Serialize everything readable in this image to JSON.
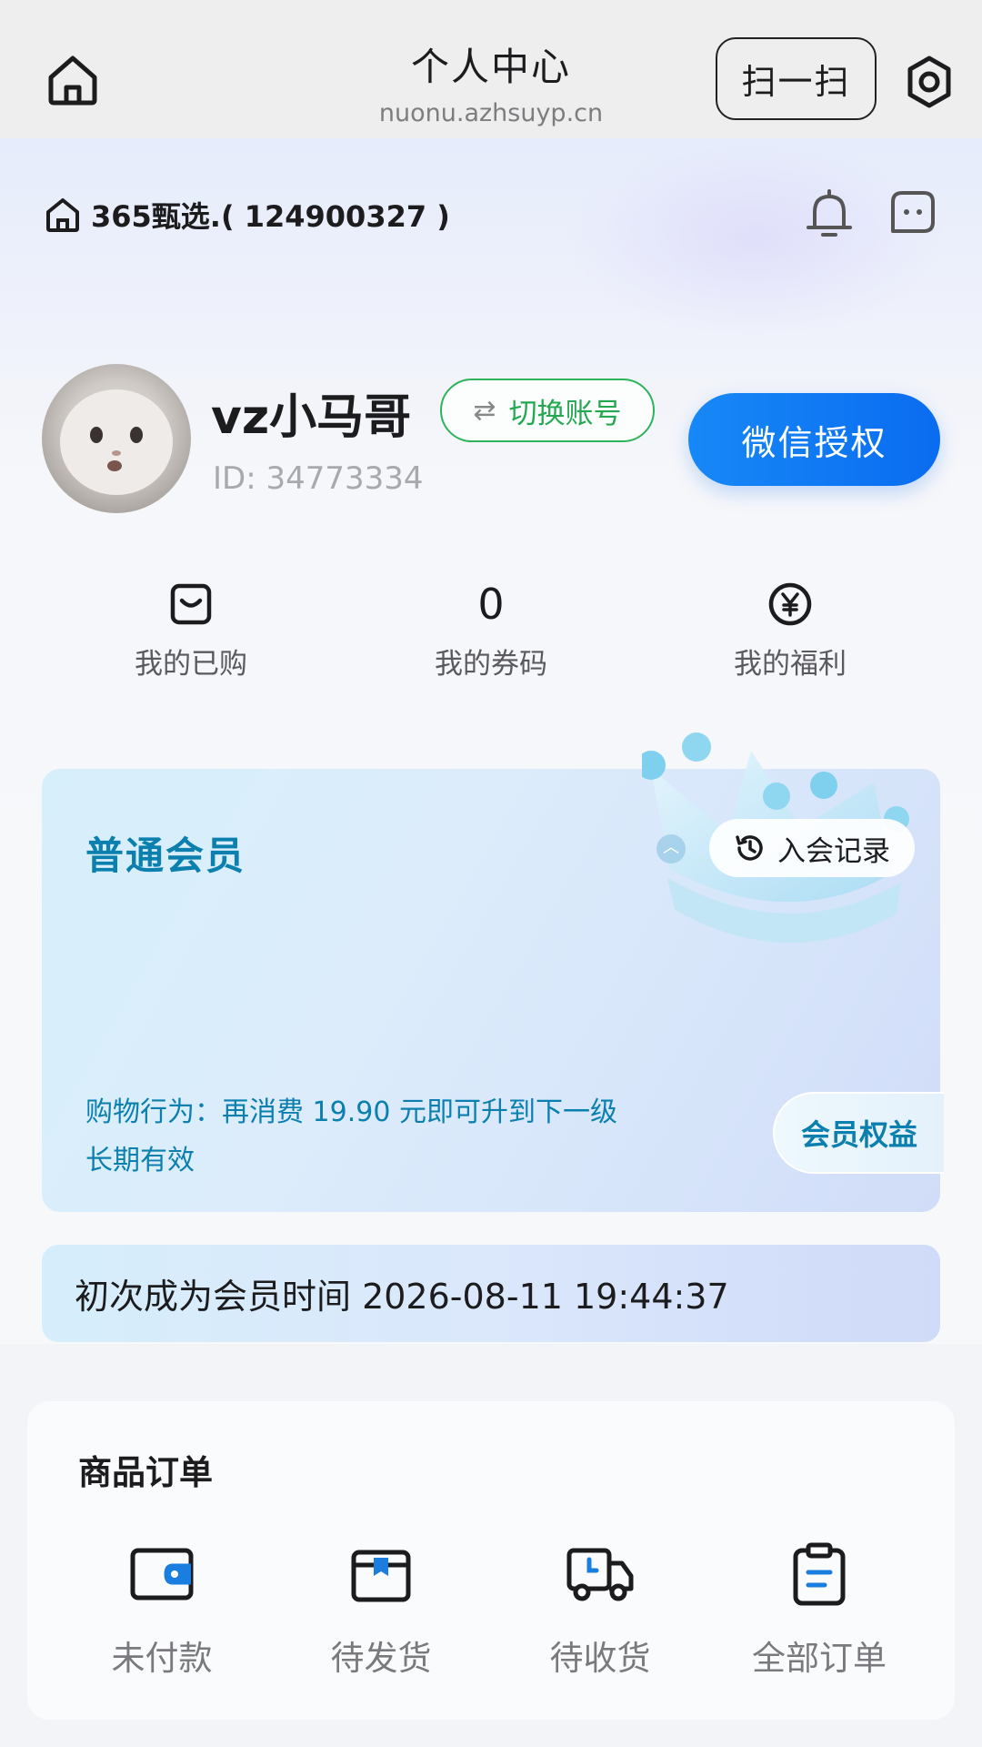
{
  "header": {
    "title": "个人中心",
    "url": "nuonu.azhsuyp.cn",
    "scan_label": "扫一扫"
  },
  "shop": {
    "name": "365甄选.( 124900327 )"
  },
  "profile": {
    "username": "vz小马哥",
    "user_id": "ID: 34773334",
    "switch_label": "切换账号",
    "wechat_label": "微信授权"
  },
  "stats": [
    {
      "label": "我的已购",
      "icon": "bag-icon"
    },
    {
      "label": "我的券码",
      "value": "0"
    },
    {
      "label": "我的福利",
      "icon": "yen-coin-icon"
    }
  ],
  "member": {
    "level": "普通会员",
    "record_label": "入会记录",
    "shopping_behavior": "购物行为：再消费 19.90 元即可升到下一级",
    "validity": "长期有效",
    "benefits_label": "会员权益",
    "first_member_time": "初次成为会员时间 2026-08-11 19:44:37"
  },
  "orders": {
    "title": "商品订单",
    "items": [
      {
        "label": "未付款",
        "icon": "wallet-icon"
      },
      {
        "label": "待发货",
        "icon": "box-icon"
      },
      {
        "label": "待收货",
        "icon": "truck-icon"
      },
      {
        "label": "全部订单",
        "icon": "clipboard-icon"
      }
    ]
  },
  "colors": {
    "accent_blue": "#0a6cf0",
    "member_teal": "#0b7fae",
    "switch_green": "#24a852",
    "order_icon_blue": "#1a7de0"
  }
}
